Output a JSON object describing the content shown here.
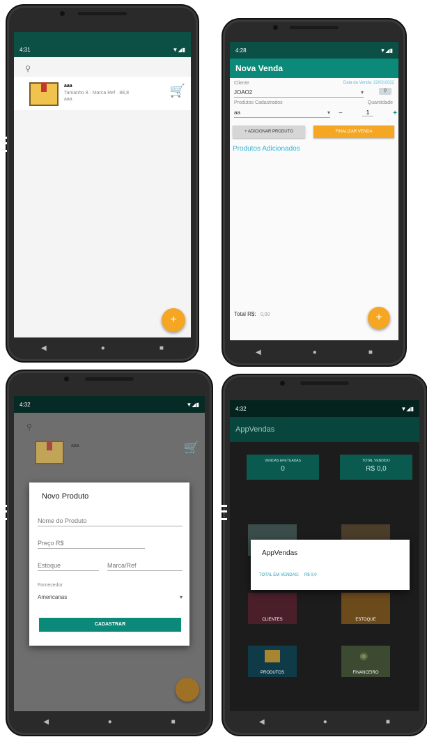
{
  "phone1": {
    "status_time": "4:31",
    "product": {
      "name": "aaa",
      "details": "Tamanho 8 · Marca Ref · 88,8",
      "subdetail": "aaa"
    },
    "fab_label": "+"
  },
  "phone2": {
    "status_time": "4:28",
    "appbar_title": "Nova Venda",
    "client_label": "Cliente",
    "date_label": "Data da Venda: 22/02/2022",
    "client_value": "JOAO2",
    "product_label": "Produtos Cadastrados",
    "qty_label": "Quantidade",
    "product_value": "aa",
    "qty_value": "1",
    "add_button": "+ ADICIONAR PRODUTO",
    "finish_button": "FINALIZAR VENDA",
    "added_title": "Produtos Adicionados",
    "total_label": "Total R$:",
    "total_value": "0,00",
    "fab_label": "+"
  },
  "phone3": {
    "status_time": "4:32",
    "dialog_title": "Novo Produto",
    "name_placeholder": "Nome do Produto",
    "price_placeholder": "Preço R$",
    "stock_placeholder": "Estoque",
    "brand_placeholder": "Marca/Ref",
    "supplier_label": "Fornecedor",
    "supplier_value": "Americanas",
    "submit_button": "CADASTRAR",
    "product_name": "aaa"
  },
  "phone4": {
    "status_time": "4:32",
    "appbar_title": "AppVendas",
    "card1_label": "VENDAS EFETUADAS",
    "card1_value": "0",
    "card2_label": "TOTAL VENDIDO",
    "card2_value": "R$ 0,0",
    "dialog_title": "AppVendas",
    "dialog_text": "TOTAL EM VENDAS:",
    "dialog_value": "R$ 0,0",
    "tiles": [
      "CLIENTES",
      "ESTOQUE",
      "PRODUTOS",
      "FINANCEIRO"
    ]
  },
  "colors": {
    "primary": "#0c8a79",
    "primary_dark": "#0b4f45",
    "accent": "#f5a623"
  }
}
